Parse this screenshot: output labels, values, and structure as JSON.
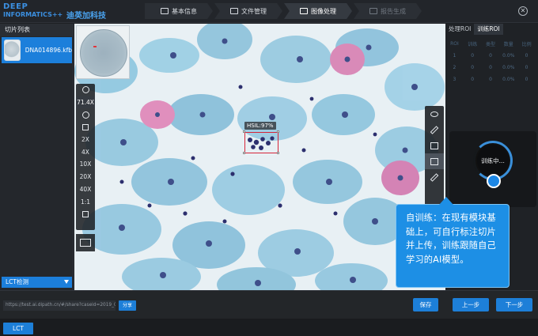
{
  "logo": {
    "line1": "DEEP",
    "line2": "INFORMATICS++",
    "name": "迪英加科技"
  },
  "steps": [
    {
      "label": "基本信息",
      "state": "done"
    },
    {
      "label": "文件管理",
      "state": "done"
    },
    {
      "label": "图像处理",
      "state": "active"
    },
    {
      "label": "报告生成",
      "state": "disabled"
    }
  ],
  "window": {
    "close_glyph": "✕"
  },
  "sidebar": {
    "title": "切片列表",
    "slides": [
      {
        "name": "DNA014896.kfb",
        "selected": true
      }
    ],
    "model_select": "LCT检测"
  },
  "viewer": {
    "zoom_level": "71.4X",
    "zoom_presets": [
      "2X",
      "4X",
      "10X",
      "20X",
      "40X",
      "1:1"
    ],
    "annotation_label": "HSIL:97%",
    "tool_icons": [
      "eye-icon",
      "brush-icon",
      "rectangle-icon",
      "select-icon",
      "ruler-icon",
      "folder-icon"
    ]
  },
  "right_panel": {
    "tabs": [
      {
        "label": "处理ROI"
      },
      {
        "label": "训练ROI",
        "active": true
      }
    ],
    "table": {
      "headers": [
        "ROI",
        "训练",
        "类型",
        "数量",
        "比例"
      ],
      "rows": [
        [
          "1",
          "0",
          "0",
          "0.0%",
          "0"
        ],
        [
          "2",
          "0",
          "0",
          "0.0%",
          "0"
        ],
        [
          "3",
          "0",
          "0",
          "0.0%",
          "0"
        ]
      ]
    },
    "status_text": "训练中..."
  },
  "callout": {
    "text": "自训练：在现有模块基础上，可自行标注切片并上传，训练跟随自己学习的AI模型。"
  },
  "bottom": {
    "share_url": "https://test.ai.dipath.cn/#/share?caseid=2019_08_23_",
    "share_label": "分享",
    "save_label": "保存",
    "prev_label": "上一步",
    "next_label": "下一步"
  },
  "footer": {
    "tab_label": "LCT"
  },
  "colors": {
    "accent": "#1d7fd8",
    "callout": "#1d8fe5",
    "roi_box": "#d6263a"
  }
}
